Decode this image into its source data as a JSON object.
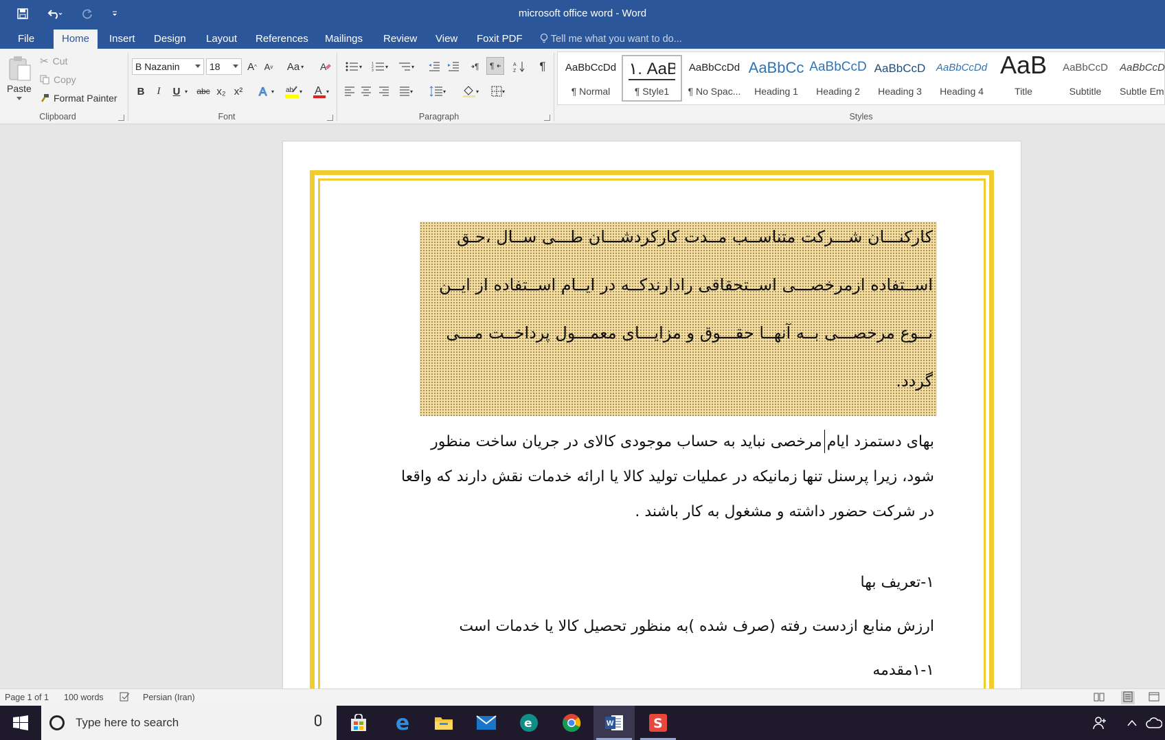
{
  "window": {
    "title": "microsoft office word - Word"
  },
  "tabs": [
    {
      "label": "File"
    },
    {
      "label": "Home"
    },
    {
      "label": "Insert"
    },
    {
      "label": "Design"
    },
    {
      "label": "Layout"
    },
    {
      "label": "References"
    },
    {
      "label": "Mailings"
    },
    {
      "label": "Review"
    },
    {
      "label": "View"
    },
    {
      "label": "Foxit PDF"
    }
  ],
  "tell_me": {
    "placeholder": "Tell me what you want to do..."
  },
  "clipboard": {
    "paste": "Paste",
    "cut": "Cut",
    "copy": "Copy",
    "format_painter": "Format Painter",
    "label": "Clipboard"
  },
  "font": {
    "name": "B Nazanin",
    "size": "18",
    "label": "Font",
    "grow": "A",
    "shrink": "A",
    "change_case": "Aa",
    "bold": "B",
    "italic": "I",
    "underline": "U",
    "strike": "abc",
    "sub": "x₂",
    "sup": "x²",
    "color_letter": "A"
  },
  "paragraph": {
    "label": "Paragraph"
  },
  "styles": {
    "label": "Styles",
    "items": [
      {
        "preview": "AaBbCcDd",
        "name": "¶ Normal"
      },
      {
        "preview": "۱. AaB",
        "name": "¶ Style1"
      },
      {
        "preview": "AaBbCcDd",
        "name": "¶ No Spac..."
      },
      {
        "preview": "AaBbCc",
        "name": "Heading 1"
      },
      {
        "preview": "AaBbCcD",
        "name": "Heading 2"
      },
      {
        "preview": "AaBbCcD",
        "name": "Heading 3"
      },
      {
        "preview": "AaBbCcDd",
        "name": "Heading 4"
      },
      {
        "preview": "AaB",
        "name": "Title"
      },
      {
        "preview": "AaBbCcD",
        "name": "Subtitle"
      },
      {
        "preview": "AaBbCcDd",
        "name": "Subtle Em"
      }
    ]
  },
  "document": {
    "shaded_lines": [
      "کارکنـــان شـــرکت متناســب مــدت کارکردشـــان طـــی ســال ،حـق",
      "اســتفاده ازمرخصـــی اســتحقاقی رادارندکــه در ایــام اســتفاده از ایــن",
      "نــوع مرخصـــی بــه آنهــا حقـــوق و مزایـــای معمـــول پرداخــت مـــی",
      "گردد."
    ],
    "body_lines": [
      "بهای دستمزد ایام مرخصی نباید به حساب موجودی کالای در جریان ساخت منظور",
      "شود، زیرا پرسنل تنها زمانیکه در عملیات تولید کالا یا ارائه خدمات نقش دارند که واقعا",
      "در شرکت حضور داشته و مشغول به کار باشند ."
    ],
    "heading_1": "۱-تعریف بها",
    "definition": "ارزش منابع ازدست رفته (صرف شده )به منظور تحصیل کالا یا خدمات است",
    "heading_2": "۱-۱مقدمه"
  },
  "status": {
    "page": "Page 1 of 1",
    "words": "100 words",
    "language": "Persian (Iran)"
  },
  "taskbar": {
    "search_placeholder": "Type here to search"
  },
  "colors": {
    "accent": "#2b579a",
    "page_border": "#f1cc2e",
    "shading": "#f6dda0"
  }
}
